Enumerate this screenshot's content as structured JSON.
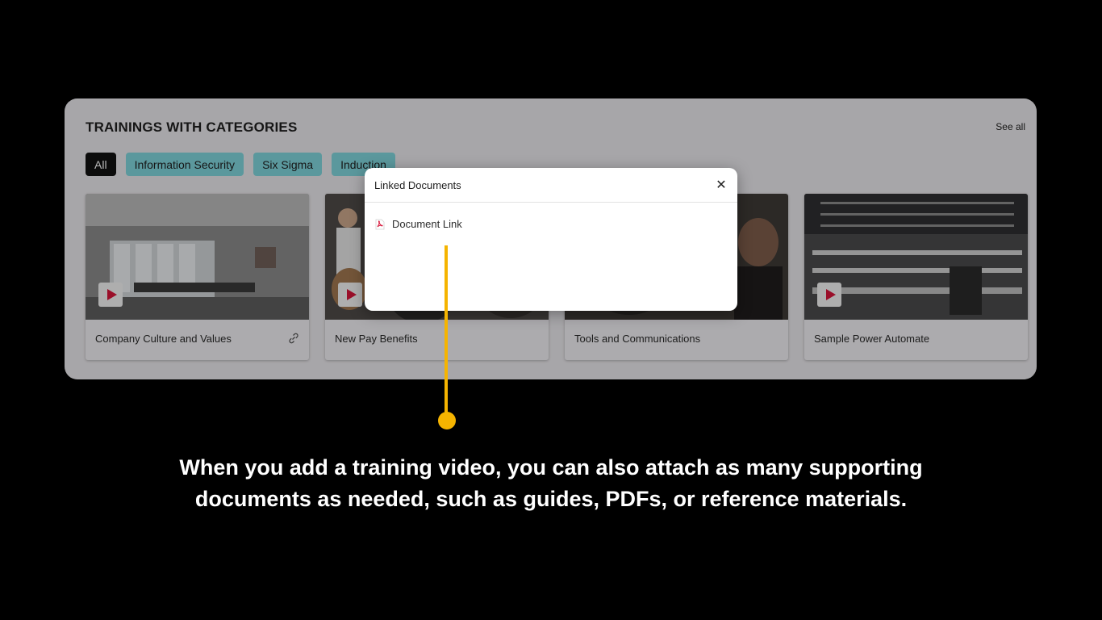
{
  "panel": {
    "title": "TRAININGS WITH CATEGORIES",
    "see_all": "See all",
    "chips": [
      {
        "label": "All"
      },
      {
        "label": "Information Security"
      },
      {
        "label": "Six Sigma"
      },
      {
        "label": "Induction"
      }
    ],
    "cards": [
      {
        "title": "Company Culture and Values"
      },
      {
        "title": "New Pay Benefits"
      },
      {
        "title": "Tools and Communications"
      },
      {
        "title": "Sample Power Automate"
      }
    ]
  },
  "modal": {
    "title": "Linked Documents",
    "close_glyph": "✕",
    "documents": [
      {
        "label": "Document Link",
        "icon": "pdf-icon"
      }
    ]
  },
  "caption": "When you add a training video, you can also attach as many supporting documents as needed, such as guides, PDFs, or reference materials.",
  "colors": {
    "accent": "#f5b400",
    "chip": "#7fd3da",
    "chip_active": "#111111",
    "play": "#d6163a"
  }
}
